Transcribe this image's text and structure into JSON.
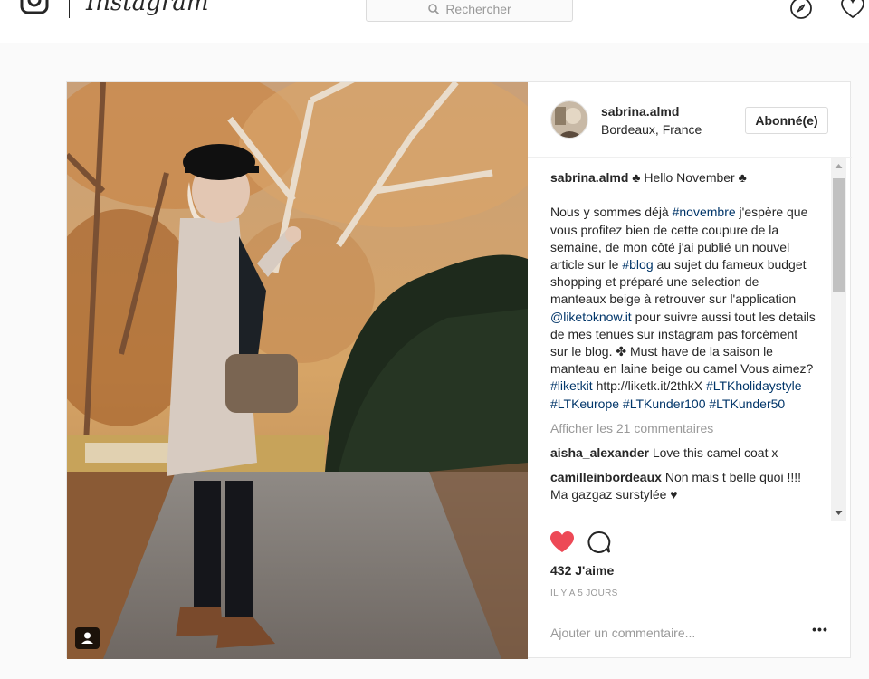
{
  "nav": {
    "logo_text": "Instagram",
    "search_placeholder": "Rechercher"
  },
  "post": {
    "owner": {
      "username": "sabrina.almd",
      "location": "Bordeaux, France"
    },
    "follow_label": "Abonné(e)",
    "caption": {
      "username": "sabrina.almd",
      "segments": [
        {
          "t": " ♣ Hello November ♣\n\nNous y sommes déjà "
        },
        {
          "t": "#novembre",
          "tag": true
        },
        {
          "t": " j'espère que vous profitez bien de cette coupure de la semaine, de mon côté j'ai publié un nouvel article sur le "
        },
        {
          "t": "#blog",
          "tag": true
        },
        {
          "t": " au sujet du fameux budget shopping et préparé une selection de manteaux beige à retrouver sur l'application "
        },
        {
          "t": "@liketoknow.it",
          "tag": true
        },
        {
          "t": " pour suivre aussi tout les details de mes tenues sur instagram pas forcément sur le blog. ✤ Must have de la saison le manteau en laine beige ou camel Vous aimez? "
        },
        {
          "t": "#liketkit",
          "tag": true
        },
        {
          "t": " http://liketk.it/2thkX "
        },
        {
          "t": "#LTKholidaystyle",
          "tag": true
        },
        {
          "t": " "
        },
        {
          "t": "#LTKeurope",
          "tag": true
        },
        {
          "t": " "
        },
        {
          "t": "#LTKunder100",
          "tag": true
        },
        {
          "t": " "
        },
        {
          "t": "#LTKunder50",
          "tag": true
        }
      ]
    },
    "view_all_comments": "Afficher les 21 commentaires",
    "comments": [
      {
        "username": "aisha_alexander",
        "text": "Love this camel coat x"
      },
      {
        "username": "camilleinbordeaux",
        "text": "Non mais t belle quoi !!!! Ma gazgaz surstylée ♥"
      }
    ],
    "likes": "432 J'aime",
    "time": "IL Y A 5 JOURS",
    "add_comment_placeholder": "Ajouter un commentaire...",
    "more_label": "•••"
  },
  "colors": {
    "like_red": "#ed4956",
    "hashtag": "#003569",
    "muted": "#999999"
  }
}
